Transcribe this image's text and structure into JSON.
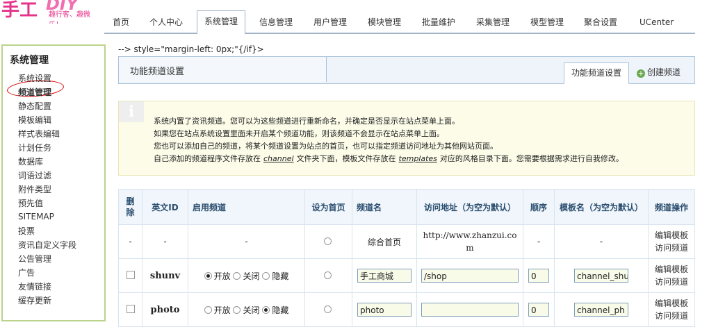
{
  "logo": {
    "main_text": "手工",
    "en_text": "DIY",
    "slogan": "趣行客、趣微乐！"
  },
  "nav": {
    "items": [
      "首页",
      "个人中心",
      "系统管理",
      "信息管理",
      "用户管理",
      "模块管理",
      "批量维护",
      "采集管理",
      "模型管理",
      "聚合设置",
      "UCenter"
    ],
    "active": "系统管理"
  },
  "sidebar": {
    "title": "系统管理",
    "items": [
      "系统设置",
      "频道管理",
      "静态配置",
      "模板编辑",
      "样式表编辑",
      "计划任务",
      "数据库",
      "词语过滤",
      "附件类型",
      "预先值",
      "SITEMAP",
      "投票",
      "资讯自定义字段",
      "公告管理",
      "广告",
      "友情链接",
      "缓存更新"
    ],
    "active": "频道管理"
  },
  "code_leak": "--> style=\"margin-left: 0px;\"{/if}>",
  "header": {
    "title": "功能频道设置",
    "tab_active": "功能频道设置",
    "tab_create": "创建频道"
  },
  "notice": {
    "icon": "info-icon",
    "line1": "系统内置了资讯频道。您可以为这些频道进行重新命名，并确定是否显示在站点菜单上面。",
    "line2": "如果您在站点系统设置里面未开启某个频道功能，则该频道不会显示在站点菜单上面。",
    "line3": "您也可以添加自己的频道，将某个频道设置为站点的首页，也可以指定频道访问地址为其他网站页面。",
    "line4_a": "自己添加的频道程序文件存放在",
    "line4_b": "channel",
    "line4_c": "文件夹下面，模板文件存放在",
    "line4_d": "templates",
    "line4_e": "对应的风格目录下面。您需要根据需求进行自我修改。"
  },
  "table": {
    "headers": {
      "delete": "删除",
      "id": "英文ID",
      "enable": "启用频道",
      "home": "设为首页",
      "name": "频道名",
      "url": "访问地址（为空为默认）",
      "order": "顺序",
      "template": "模板名（为空为默认）",
      "ops": "频道操作"
    },
    "radio_labels": {
      "open": "开放",
      "close": "关闭",
      "hide": "隐藏"
    },
    "ops_labels": {
      "edit_template": "编辑模板",
      "visit": "访问频道"
    },
    "rows": [
      {
        "delete": "-",
        "id": "-",
        "enable": "-",
        "name": "综合首页",
        "url": "http://www.zhanzui.com",
        "order": "-",
        "template": "-",
        "status": ""
      },
      {
        "delete": "",
        "id": "shunv",
        "enable": "",
        "name": "手工商城",
        "url": "/shop",
        "order": "0",
        "template": "channel_shu",
        "status": "open"
      },
      {
        "delete": "",
        "id": "photo",
        "enable": "",
        "name": "photo",
        "url": "",
        "order": "0",
        "template": "channel_ph",
        "status": "hide"
      }
    ]
  }
}
